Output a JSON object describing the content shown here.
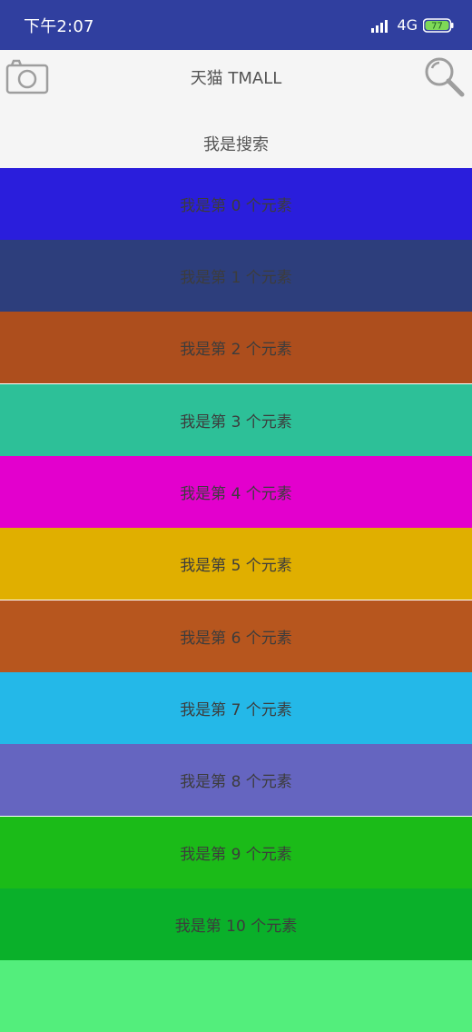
{
  "status_bar": {
    "time": "下午2:07",
    "network": "4G",
    "battery_level": "77",
    "background_color": "#303f9f"
  },
  "header": {
    "title": "天猫 TMALL",
    "search_label": "我是搜索",
    "camera_icon": "camera-icon",
    "search_icon": "magnifier-icon"
  },
  "list": {
    "items": [
      {
        "label": "我是第 0 个元素",
        "color": "#2a1edc"
      },
      {
        "label": "我是第 1 个元素",
        "color": "#2d3e7c"
      },
      {
        "label": "我是第 2 个元素",
        "color": "#ad4e1d"
      },
      {
        "label": "我是第 3 个元素",
        "color": "#2dc098"
      },
      {
        "label": "我是第 4 个元素",
        "color": "#e300cd"
      },
      {
        "label": "我是第 5 个元素",
        "color": "#e0af00"
      },
      {
        "label": "我是第 6 个元素",
        "color": "#b7561e"
      },
      {
        "label": "我是第 7 个元素",
        "color": "#24b8e8"
      },
      {
        "label": "我是第 8 个元素",
        "color": "#6565c0"
      },
      {
        "label": "我是第 9 个元素",
        "color": "#1bbb18"
      },
      {
        "label": "我是第 10 个元素",
        "color": "#0ab02a"
      },
      {
        "label": "",
        "color": "#53ee7c"
      }
    ]
  }
}
